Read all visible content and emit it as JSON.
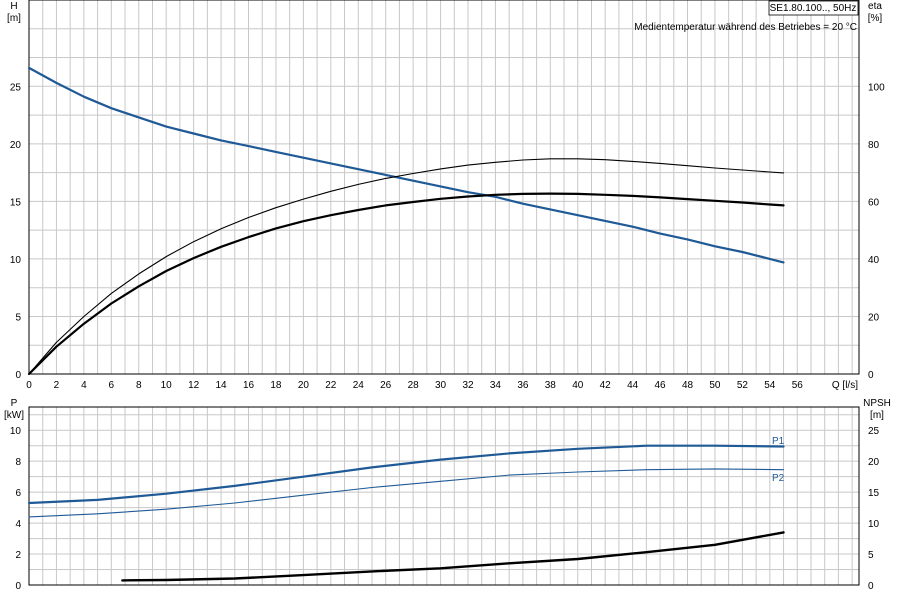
{
  "chart_data": [
    {
      "type": "line",
      "title_box": "SE1.80.100.., 50Hz",
      "annotation": "Medientemperatur während des Betriebes = 20 °C",
      "left_axis": {
        "label": "H",
        "unit": "[m]",
        "ticks": [
          "0",
          "5",
          "10",
          "15",
          "20",
          "25"
        ],
        "range": [
          0,
          32.5
        ]
      },
      "right_axis": {
        "label": "eta",
        "unit": "[%]",
        "ticks": [
          "0",
          "20",
          "40",
          "60",
          "80",
          "100"
        ],
        "range": [
          0,
          130
        ]
      },
      "x_axis": {
        "label": "Q [l/s]",
        "ticks": [
          "0",
          "2",
          "4",
          "6",
          "8",
          "10",
          "12",
          "14",
          "16",
          "18",
          "20",
          "22",
          "24",
          "26",
          "28",
          "30",
          "32",
          "34",
          "36",
          "38",
          "40",
          "42",
          "44",
          "46",
          "48",
          "50",
          "52",
          "54",
          "56"
        ],
        "range": [
          0,
          60.5
        ]
      },
      "grid": true,
      "series": [
        {
          "axis": "left",
          "color": "#1f5a96",
          "width": 2.2,
          "points": [
            [
              0,
              26.6
            ],
            [
              2,
              25.3
            ],
            [
              4,
              24.1
            ],
            [
              6,
              23.1
            ],
            [
              8,
              22.3
            ],
            [
              10,
              21.5
            ],
            [
              12,
              20.9
            ],
            [
              14,
              20.3
            ],
            [
              16,
              19.8
            ],
            [
              18,
              19.3
            ],
            [
              20,
              18.8
            ],
            [
              22,
              18.3
            ],
            [
              24,
              17.8
            ],
            [
              26,
              17.3
            ],
            [
              28,
              16.8
            ],
            [
              30,
              16.3
            ],
            [
              32,
              15.8
            ],
            [
              34,
              15.4
            ],
            [
              36,
              14.8
            ],
            [
              38,
              14.3
            ],
            [
              40,
              13.8
            ],
            [
              42,
              13.3
            ],
            [
              44,
              12.8
            ],
            [
              46,
              12.2
            ],
            [
              48,
              11.7
            ],
            [
              50,
              11.1
            ],
            [
              52,
              10.6
            ],
            [
              54,
              10.0
            ],
            [
              55,
              9.7
            ]
          ]
        },
        {
          "axis": "right",
          "color": "#000000",
          "width": 2.2,
          "points": [
            [
              0,
              0
            ],
            [
              2,
              9.5
            ],
            [
              4,
              17.5
            ],
            [
              6,
              24.5
            ],
            [
              8,
              30.5
            ],
            [
              10,
              35.8
            ],
            [
              12,
              40.3
            ],
            [
              14,
              44.2
            ],
            [
              16,
              47.6
            ],
            [
              18,
              50.6
            ],
            [
              20,
              53.1
            ],
            [
              22,
              55.2
            ],
            [
              24,
              57.0
            ],
            [
              26,
              58.6
            ],
            [
              28,
              59.8
            ],
            [
              30,
              60.9
            ],
            [
              32,
              61.7
            ],
            [
              34,
              62.3
            ],
            [
              36,
              62.6
            ],
            [
              38,
              62.7
            ],
            [
              40,
              62.6
            ],
            [
              42,
              62.3
            ],
            [
              44,
              61.9
            ],
            [
              46,
              61.4
            ],
            [
              48,
              60.8
            ],
            [
              50,
              60.2
            ],
            [
              52,
              59.6
            ],
            [
              54,
              58.9
            ],
            [
              55,
              58.6
            ]
          ]
        },
        {
          "axis": "right",
          "color": "#000000",
          "width": 1.1,
          "points": [
            [
              0,
              0
            ],
            [
              2,
              11.0
            ],
            [
              4,
              20.0
            ],
            [
              6,
              28.0
            ],
            [
              8,
              34.8
            ],
            [
              10,
              40.8
            ],
            [
              12,
              46.0
            ],
            [
              14,
              50.5
            ],
            [
              16,
              54.4
            ],
            [
              18,
              57.8
            ],
            [
              20,
              60.8
            ],
            [
              22,
              63.5
            ],
            [
              24,
              65.9
            ],
            [
              26,
              68.0
            ],
            [
              28,
              69.7
            ],
            [
              30,
              71.3
            ],
            [
              32,
              72.6
            ],
            [
              34,
              73.6
            ],
            [
              36,
              74.4
            ],
            [
              38,
              74.8
            ],
            [
              40,
              74.8
            ],
            [
              42,
              74.5
            ],
            [
              44,
              73.9
            ],
            [
              46,
              73.2
            ],
            [
              48,
              72.4
            ],
            [
              50,
              71.6
            ],
            [
              52,
              70.9
            ],
            [
              54,
              70.2
            ],
            [
              55,
              69.9
            ]
          ]
        }
      ]
    },
    {
      "type": "line",
      "left_axis": {
        "label": "P",
        "unit": "[kW]",
        "ticks": [
          "0",
          "2",
          "4",
          "6",
          "8",
          "10"
        ],
        "range": [
          0,
          11.5
        ]
      },
      "right_axis": {
        "label": "NPSH",
        "unit": "[m]",
        "ticks": [
          "0",
          "5",
          "10",
          "15",
          "20",
          "25"
        ],
        "range": [
          0,
          28.75
        ]
      },
      "x_axis": {
        "range": [
          0,
          60.5
        ]
      },
      "grid": true,
      "series": [
        {
          "name": "P1",
          "axis": "left",
          "color": "#1f5a96",
          "width": 2.2,
          "points": [
            [
              0,
              5.3
            ],
            [
              5,
              5.5
            ],
            [
              10,
              5.9
            ],
            [
              15,
              6.4
            ],
            [
              20,
              7.0
            ],
            [
              25,
              7.6
            ],
            [
              30,
              8.1
            ],
            [
              35,
              8.5
            ],
            [
              40,
              8.8
            ],
            [
              45,
              9.0
            ],
            [
              50,
              9.0
            ],
            [
              55,
              8.95
            ]
          ]
        },
        {
          "name": "P2",
          "axis": "left",
          "color": "#1f5a96",
          "width": 1.1,
          "points": [
            [
              0,
              4.4
            ],
            [
              5,
              4.6
            ],
            [
              10,
              4.9
            ],
            [
              15,
              5.3
            ],
            [
              20,
              5.8
            ],
            [
              25,
              6.3
            ],
            [
              30,
              6.7
            ],
            [
              35,
              7.1
            ],
            [
              40,
              7.3
            ],
            [
              45,
              7.45
            ],
            [
              50,
              7.5
            ],
            [
              55,
              7.45
            ]
          ]
        },
        {
          "axis": "right",
          "color": "#000000",
          "width": 2.4,
          "points": [
            [
              6.8,
              0.75
            ],
            [
              10,
              0.8
            ],
            [
              15,
              1.05
            ],
            [
              20,
              1.6
            ],
            [
              25,
              2.2
            ],
            [
              30,
              2.7
            ],
            [
              35,
              3.5
            ],
            [
              40,
              4.2
            ],
            [
              45,
              5.3
            ],
            [
              50,
              6.5
            ],
            [
              55,
              8.5
            ]
          ]
        }
      ]
    }
  ]
}
